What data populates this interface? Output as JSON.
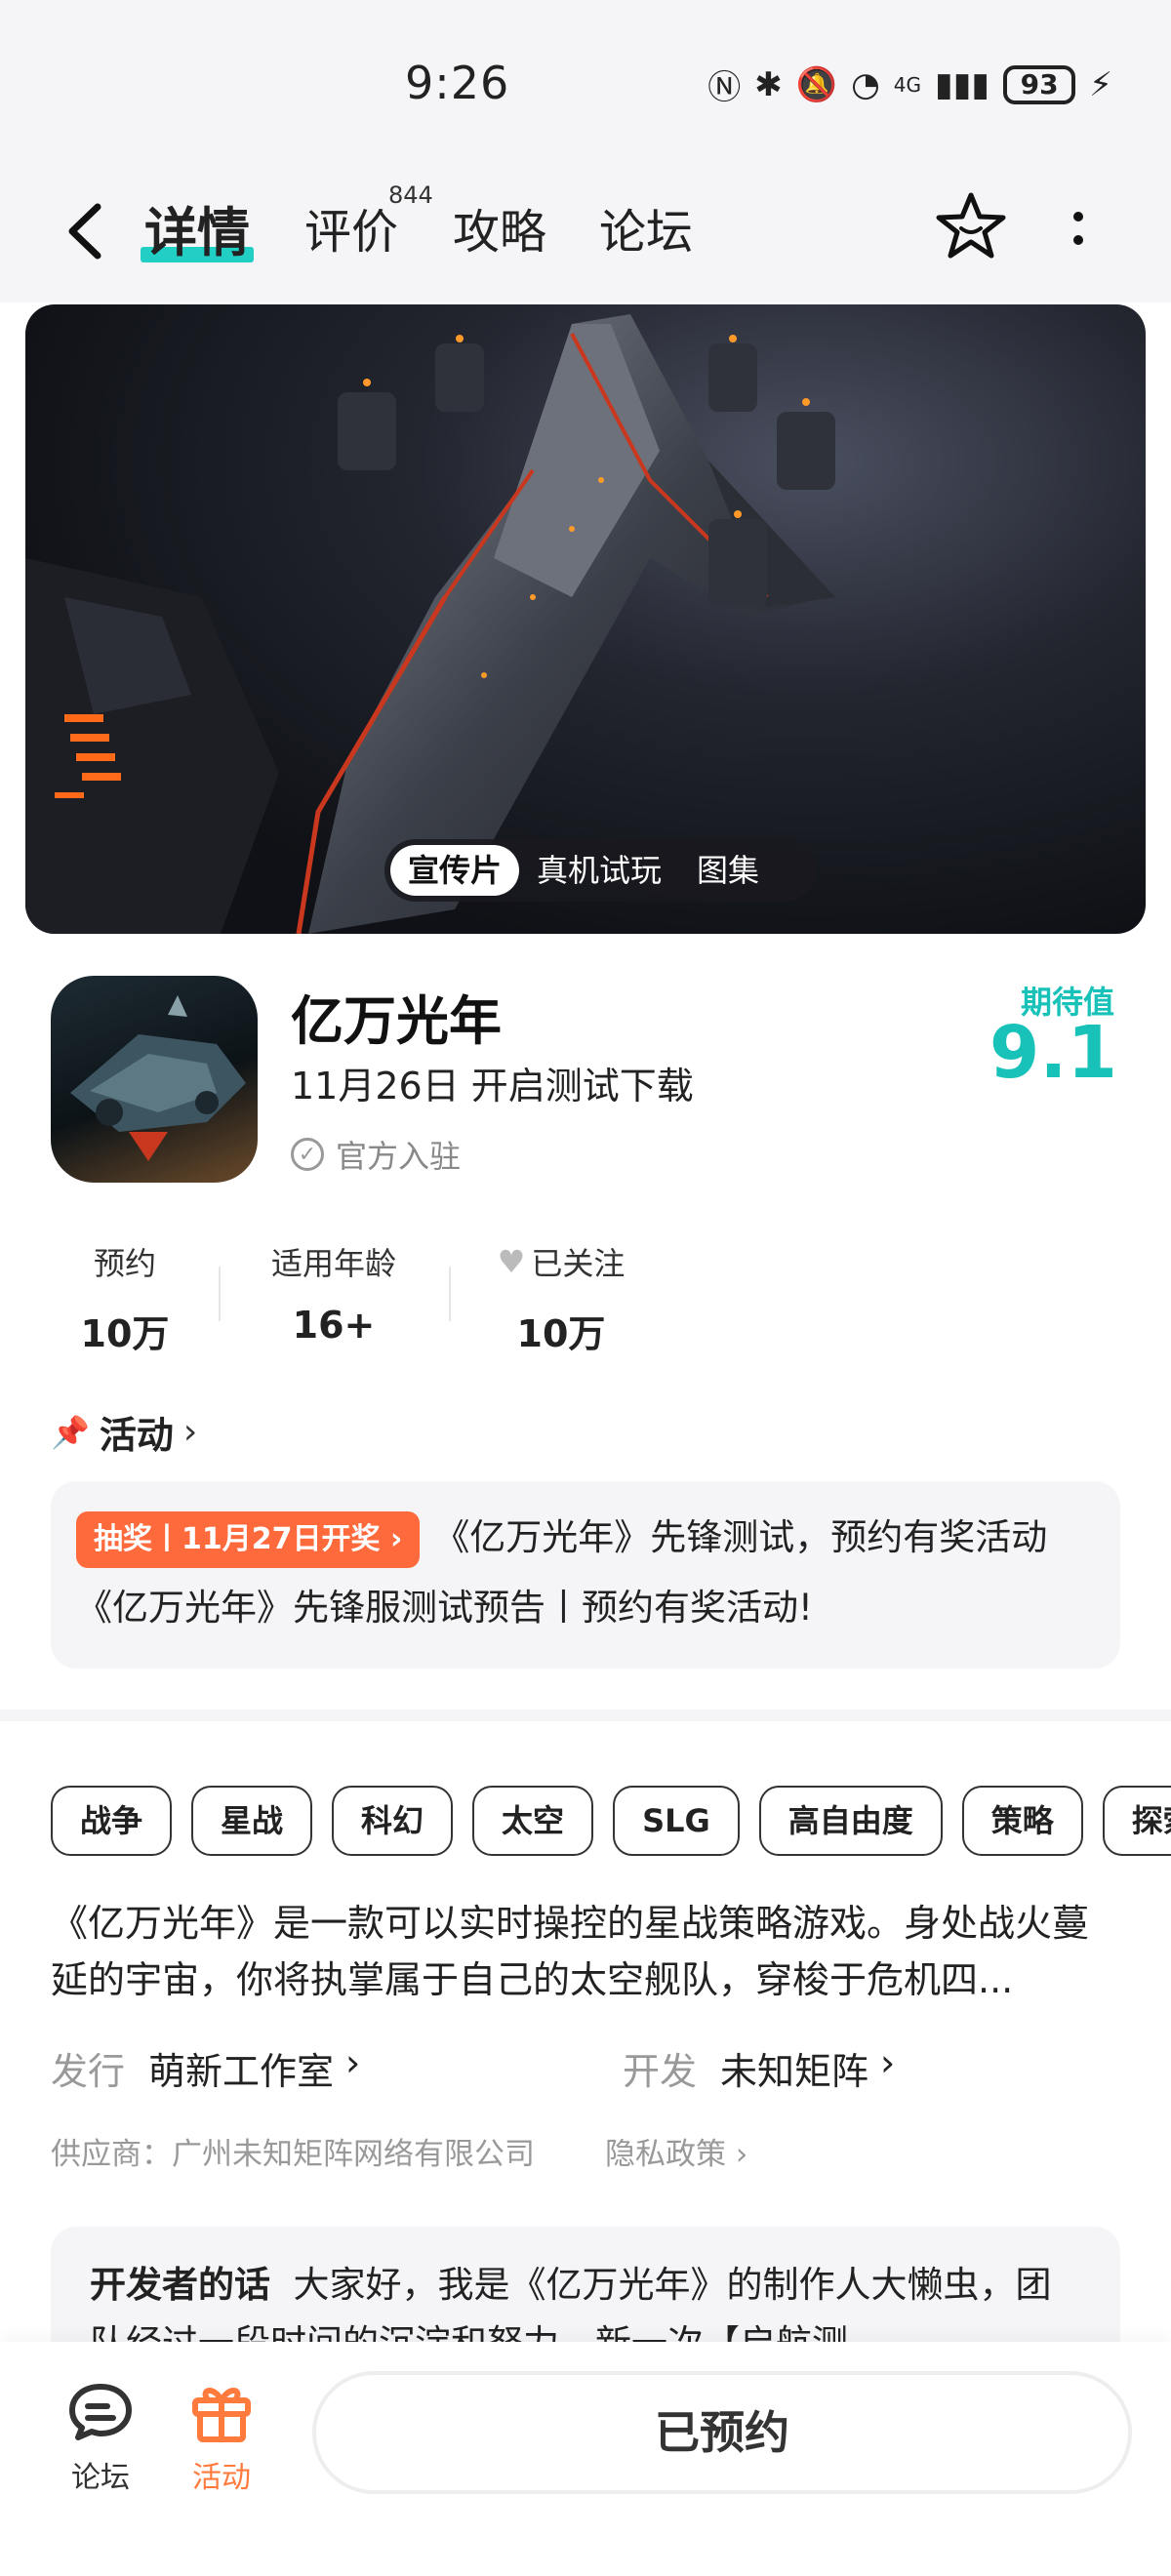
{
  "status_bar": {
    "time": "9:26",
    "network": "4G",
    "battery": "93"
  },
  "nav": {
    "tabs": [
      {
        "label": "详情"
      },
      {
        "label": "评价"
      },
      {
        "label": "攻略"
      },
      {
        "label": "论坛"
      }
    ],
    "review_count": "844"
  },
  "media": {
    "tabs": [
      "宣传片",
      "真机试玩",
      "图集"
    ]
  },
  "app": {
    "name": "亿万光年",
    "date_line": "11月26日 开启测试下载",
    "official": "官方入驻",
    "expect_label": "期待值",
    "expect_value": "9.1"
  },
  "stats": [
    {
      "label": "预约",
      "value": "10万"
    },
    {
      "label": "适用年龄",
      "value": "16+"
    },
    {
      "label": "已关注",
      "value": "10万"
    }
  ],
  "activity": {
    "header": "活动",
    "tag": "抽奖丨11月27日开奖",
    "text": "《亿万光年》先锋测试，预约有奖活动 《亿万光年》先锋服测试预告丨预约有奖活动!"
  },
  "tags": [
    "战争",
    "星战",
    "科幻",
    "太空",
    "SLG",
    "高自由度",
    "策略",
    "探索"
  ],
  "description": "《亿万光年》是一款可以实时操控的星战策略游戏。身处战火蔓延的宇宙，你将执掌属于自己的太空舰队，穿梭于危机四...",
  "publisher": {
    "key": "发行",
    "value": "萌新工作室"
  },
  "developer": {
    "key": "开发",
    "value": "未知矩阵"
  },
  "supplier": "供应商：广州未知矩阵网络有限公司",
  "privacy": "隐私政策",
  "dev_words": {
    "title": "开发者的话",
    "text": "大家好，我是《亿万光年》的制作人大懒虫，团队经过一段时间的沉淀和努力，新一次【启航测"
  },
  "bottom": {
    "forum": "论坛",
    "activity": "活动",
    "reserved": "已预约"
  },
  "colors": {
    "accent": "#18c2b9",
    "tab_underline": "#21cfc4",
    "activity_tag": "#ff6a3d",
    "bottom_active": "#ff7a3d"
  }
}
